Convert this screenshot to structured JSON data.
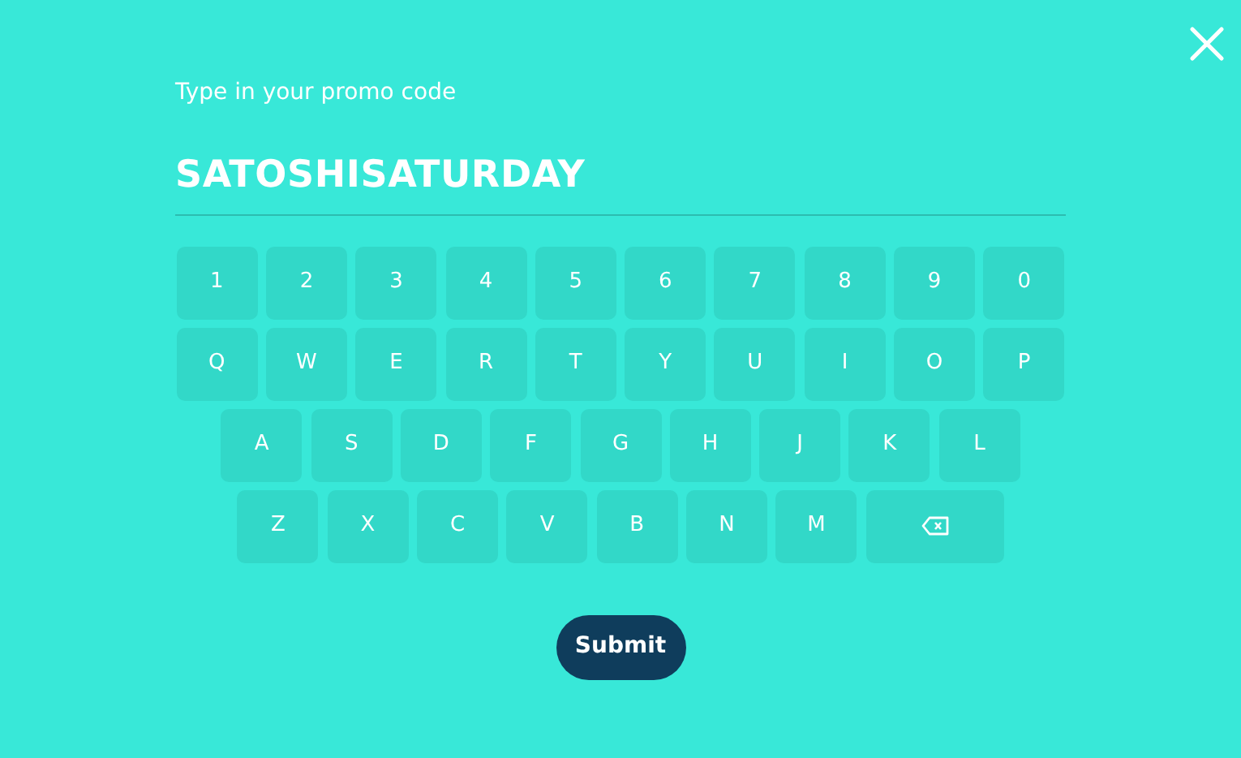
{
  "prompt": "Type in your promo code",
  "code": {
    "value": "SATOSHISATURDAY"
  },
  "keyboard": [
    {
      "keys": [
        {
          "kind": "char",
          "label": "1"
        },
        {
          "kind": "char",
          "label": "2"
        },
        {
          "kind": "char",
          "label": "3"
        },
        {
          "kind": "char",
          "label": "4"
        },
        {
          "kind": "char",
          "label": "5"
        },
        {
          "kind": "char",
          "label": "6"
        },
        {
          "kind": "char",
          "label": "7"
        },
        {
          "kind": "char",
          "label": "8"
        },
        {
          "kind": "char",
          "label": "9"
        },
        {
          "kind": "char",
          "label": "0"
        }
      ]
    },
    {
      "keys": [
        {
          "kind": "char",
          "label": "Q"
        },
        {
          "kind": "char",
          "label": "W"
        },
        {
          "kind": "char",
          "label": "E"
        },
        {
          "kind": "char",
          "label": "R"
        },
        {
          "kind": "char",
          "label": "T"
        },
        {
          "kind": "char",
          "label": "Y"
        },
        {
          "kind": "char",
          "label": "U"
        },
        {
          "kind": "char",
          "label": "I"
        },
        {
          "kind": "char",
          "label": "O"
        },
        {
          "kind": "char",
          "label": "P"
        }
      ]
    },
    {
      "keys": [
        {
          "kind": "char",
          "label": "A"
        },
        {
          "kind": "char",
          "label": "S"
        },
        {
          "kind": "char",
          "label": "D"
        },
        {
          "kind": "char",
          "label": "F"
        },
        {
          "kind": "char",
          "label": "G"
        },
        {
          "kind": "char",
          "label": "H"
        },
        {
          "kind": "char",
          "label": "J"
        },
        {
          "kind": "char",
          "label": "K"
        },
        {
          "kind": "char",
          "label": "L"
        }
      ]
    },
    {
      "keys": [
        {
          "kind": "char",
          "label": "Z"
        },
        {
          "kind": "char",
          "label": "X"
        },
        {
          "kind": "char",
          "label": "C"
        },
        {
          "kind": "char",
          "label": "V"
        },
        {
          "kind": "char",
          "label": "B"
        },
        {
          "kind": "char",
          "label": "N"
        },
        {
          "kind": "char",
          "label": "M"
        },
        {
          "kind": "backspace"
        }
      ]
    }
  ],
  "submit": {
    "label": "Submit"
  }
}
